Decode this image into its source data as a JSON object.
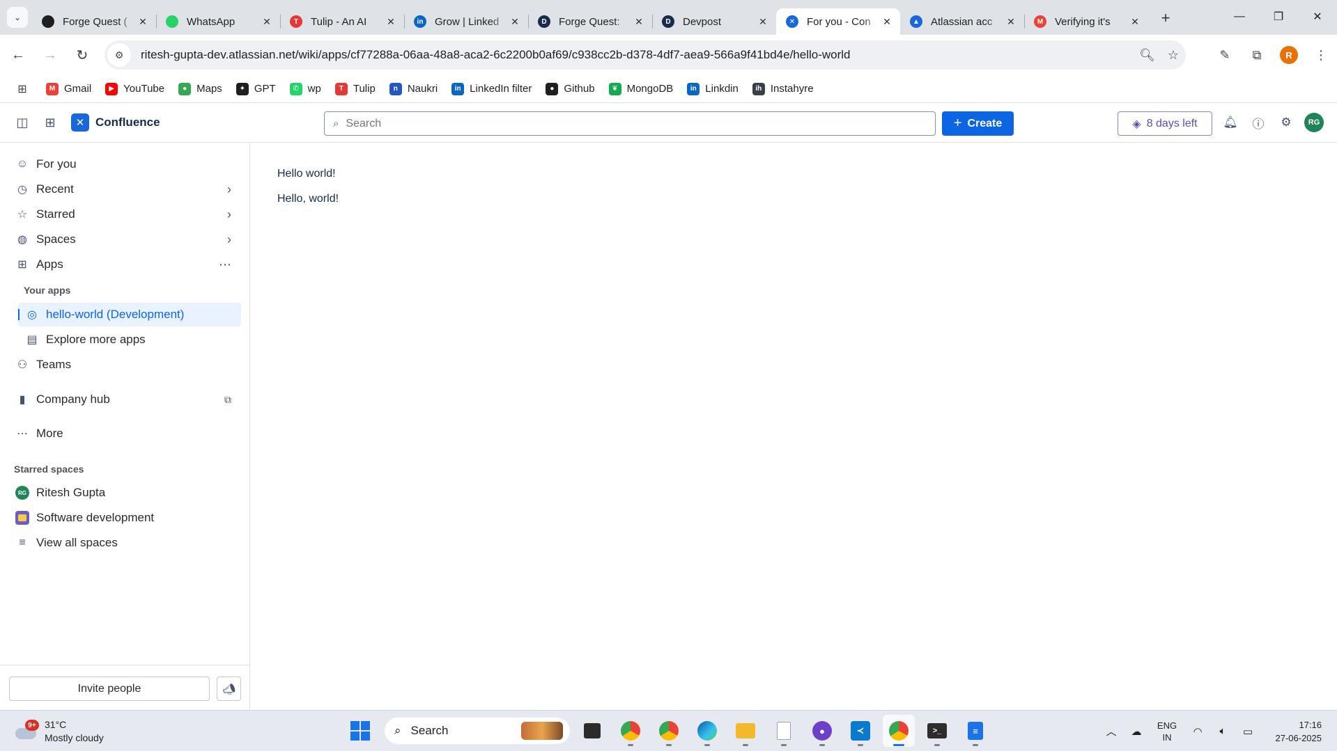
{
  "browser": {
    "tabs": [
      {
        "title": "Forge Quest (",
        "favicon_color": "#1f1f1f",
        "favicon_text": "",
        "active": false
      },
      {
        "title": "WhatsApp",
        "favicon_color": "#25d366",
        "favicon_text": "",
        "active": false
      },
      {
        "title": "Tulip - An AI",
        "favicon_color": "#e53935",
        "favicon_text": "T",
        "active": false
      },
      {
        "title": "Grow | Linked",
        "favicon_color": "#0a66c2",
        "favicon_text": "in",
        "active": false
      },
      {
        "title": "Forge Quest:",
        "favicon_color": "#172b4d",
        "favicon_text": "D",
        "active": false
      },
      {
        "title": "Devpost",
        "favicon_color": "#172b4d",
        "favicon_text": "D",
        "active": false
      },
      {
        "title": "For you - Con",
        "favicon_color": "#1868db",
        "favicon_text": "✕",
        "active": true
      },
      {
        "title": "Atlassian acc",
        "favicon_color": "#1868db",
        "favicon_text": "▲",
        "active": false
      },
      {
        "title": "Verifying it's",
        "favicon_color": "#ea4335",
        "favicon_text": "M",
        "active": false
      }
    ],
    "url": "ritesh-gupta-dev.atlassian.net/wiki/apps/cf77288a-06aa-48a8-aca2-6c2200b0af69/c938cc2b-d378-4df7-aea9-566a9f41bd4e/hello-world",
    "profile_initial": "R",
    "bookmarks": [
      {
        "label": "Gmail",
        "color": "#ea4335",
        "text": "M"
      },
      {
        "label": "YouTube",
        "color": "#ff0000",
        "text": "▶"
      },
      {
        "label": "Maps",
        "color": "#34a853",
        "text": "●"
      },
      {
        "label": "GPT",
        "color": "#1f1f1f",
        "text": "✦"
      },
      {
        "label": "wp",
        "color": "#25d366",
        "text": "✆"
      },
      {
        "label": "Tulip",
        "color": "#e53935",
        "text": "T"
      },
      {
        "label": "Naukri",
        "color": "#2457c5",
        "text": "n"
      },
      {
        "label": "LinkedIn filter",
        "color": "#0a66c2",
        "text": "in"
      },
      {
        "label": "Github",
        "color": "#1f1f1f",
        "text": "●"
      },
      {
        "label": "MongoDB",
        "color": "#13aa52",
        "text": "❦"
      },
      {
        "label": "Linkdin",
        "color": "#0a66c2",
        "text": "in"
      },
      {
        "label": "Instahyre",
        "color": "#3a3f47",
        "text": "ih"
      }
    ]
  },
  "confluence": {
    "product_name": "Confluence",
    "search_placeholder": "Search",
    "create_label": "Create",
    "trial_label": "8 days left",
    "user_initials": "RG"
  },
  "sidebar": {
    "items": {
      "for_you": "For you",
      "recent": "Recent",
      "starred": "Starred",
      "spaces": "Spaces",
      "apps": "Apps",
      "your_apps": "Your apps",
      "app_active": "hello-world (Development)",
      "explore_apps": "Explore more apps",
      "teams": "Teams",
      "company_hub": "Company hub",
      "more": "More"
    },
    "starred_spaces_heading": "Starred spaces",
    "starred_spaces": [
      {
        "label": "Ritesh Gupta",
        "initials": "RG"
      },
      {
        "label": "Software development"
      }
    ],
    "view_all_spaces": "View all spaces",
    "invite_label": "Invite people"
  },
  "main": {
    "lines": [
      "Hello world!",
      "Hello, world!"
    ]
  },
  "taskbar": {
    "weather_temp": "31°C",
    "weather_desc": "Mostly cloudy",
    "weather_badge": "9+",
    "search_label": "Search",
    "lang_line1": "ENG",
    "lang_line2": "IN",
    "time": "17:16",
    "date": "27-06-2025"
  }
}
